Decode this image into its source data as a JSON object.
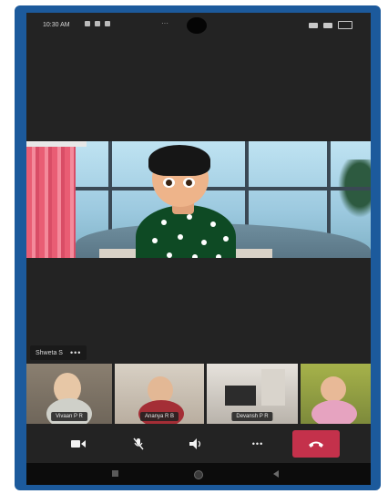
{
  "status_bar": {
    "time": "10:30 AM",
    "dots": "···"
  },
  "main_video": {
    "description_icon": "animated-avatar-video"
  },
  "presenter_chip": {
    "name": "Shweta S",
    "more": "•••"
  },
  "participants": [
    {
      "label": "Vivaan P R"
    },
    {
      "label": "Ananya R B"
    },
    {
      "label": "Devansh P R"
    },
    {
      "label": ""
    }
  ],
  "controls": {
    "camera": "camera-icon",
    "mic": "mic-off-icon",
    "speaker": "speaker-icon",
    "more": "•••",
    "end_call": "end-call-icon",
    "end_call_color": "#c4314b"
  },
  "colors": {
    "frame": "#1c5a9c",
    "screen_bg": "#232323"
  }
}
